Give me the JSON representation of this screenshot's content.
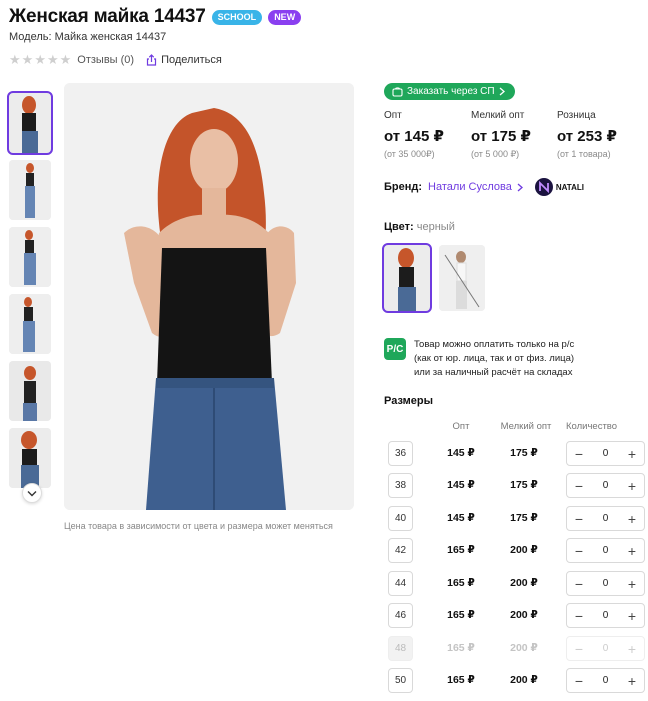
{
  "product": {
    "title": "Женская майка 14437",
    "badges": {
      "school": "SCHOOL",
      "new": "NEW"
    },
    "model": "Модель: Майка женская 14437",
    "reviews": "Отзывы (0)",
    "share": "Поделиться",
    "rating_stars": 0
  },
  "gallery": {
    "price_note": "Цена товара в зависимости от цвета и размера может меняться"
  },
  "order": {
    "sp_button": "Заказать через СП"
  },
  "prices": [
    {
      "label": "Опт",
      "value": "от 145 ₽",
      "min": "(от 35 000₽)"
    },
    {
      "label": "Мелкий опт",
      "value": "от 175 ₽",
      "min": "(от 5 000 ₽)"
    },
    {
      "label": "Розница",
      "value": "от 253 ₽",
      "min": "(от 1 товара)"
    }
  ],
  "brand": {
    "label": "Бренд:",
    "name": "Натали Суслова",
    "logo_text": "NATALI"
  },
  "color": {
    "label": "Цвет:",
    "value": "черный"
  },
  "payment": {
    "icon_text": "Р/С",
    "line1": "Товар можно оплатить только на р/с",
    "line2": "(как от юр. лица, так и от физ. лица)",
    "line3": "или за наличный расчёт на складах"
  },
  "sizes": {
    "title": "Размеры",
    "headers": {
      "opt": "Опт",
      "small": "Мелкий опт",
      "qty": "Количество"
    },
    "minus": "−",
    "plus": "+",
    "rows": [
      {
        "size": "36",
        "opt": "145 ₽",
        "small": "175 ₽",
        "qty": "0",
        "available": true
      },
      {
        "size": "38",
        "opt": "145 ₽",
        "small": "175 ₽",
        "qty": "0",
        "available": true
      },
      {
        "size": "40",
        "opt": "145 ₽",
        "small": "175 ₽",
        "qty": "0",
        "available": true
      },
      {
        "size": "42",
        "opt": "165 ₽",
        "small": "200 ₽",
        "qty": "0",
        "available": true
      },
      {
        "size": "44",
        "opt": "165 ₽",
        "small": "200 ₽",
        "qty": "0",
        "available": true
      },
      {
        "size": "46",
        "opt": "165 ₽",
        "small": "200 ₽",
        "qty": "0",
        "available": true
      },
      {
        "size": "48",
        "opt": "165 ₽",
        "small": "200 ₽",
        "qty": "0",
        "available": false
      },
      {
        "size": "50",
        "opt": "165 ₽",
        "small": "200 ₽",
        "qty": "0",
        "available": true
      }
    ]
  },
  "colors": {
    "accent": "#6f3be0",
    "green": "#1fa75a",
    "school": "#39b4e8",
    "new": "#8a3ff0"
  }
}
